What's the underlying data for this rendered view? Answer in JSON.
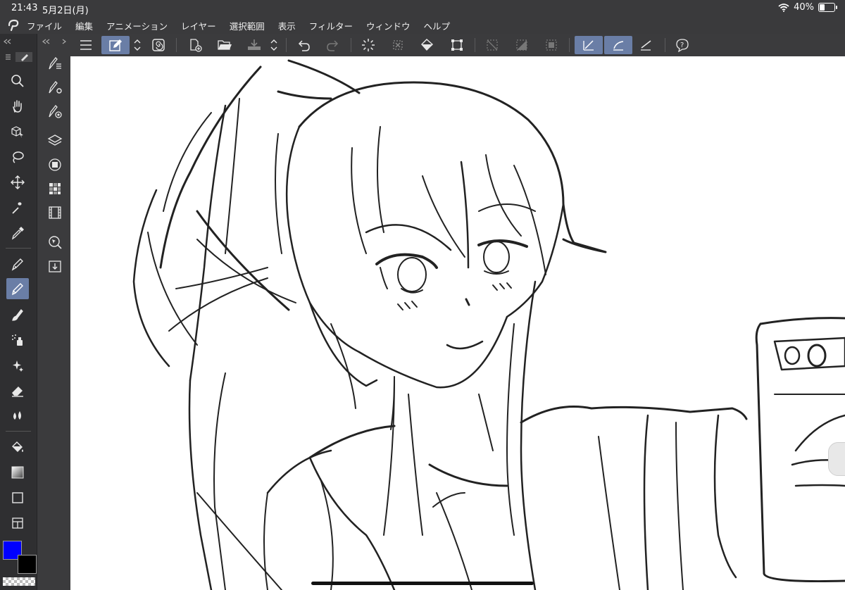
{
  "status_bar": {
    "time": "21:43",
    "date": "5月2日(月)",
    "battery_text": "40%",
    "battery_level": 0.4
  },
  "menubar": {
    "items": [
      "ファイル",
      "編集",
      "アニメーション",
      "レイヤー",
      "選択範囲",
      "表示",
      "フィルター",
      "ウィンドウ",
      "ヘルプ"
    ]
  },
  "colors": {
    "main_color": "#0000ff",
    "sub_color": "#000000",
    "accent": "#6a7ea6",
    "panel": "#3b3b3d"
  },
  "tools": {
    "main": [
      "zoom-icon",
      "hand-icon",
      "object-select-icon",
      "lasso-select-icon",
      "move-icon",
      "auto-select-icon",
      "eyedropper-icon",
      "pen-icon",
      "pencil-icon",
      "brush-icon",
      "airbrush-icon",
      "decoration-icon",
      "eraser-icon",
      "blend-icon",
      "fill-icon",
      "gradient-icon",
      "figure-icon",
      "frame-icon"
    ],
    "active": "pencil-icon",
    "subtool": [
      "subtool-detail-icon",
      "tool-property-icon",
      "brush-size-icon",
      "layer-icon",
      "layer-property-icon",
      "color-set-icon",
      "animation-cels-icon",
      "navigator-icon",
      "material-icon"
    ]
  }
}
